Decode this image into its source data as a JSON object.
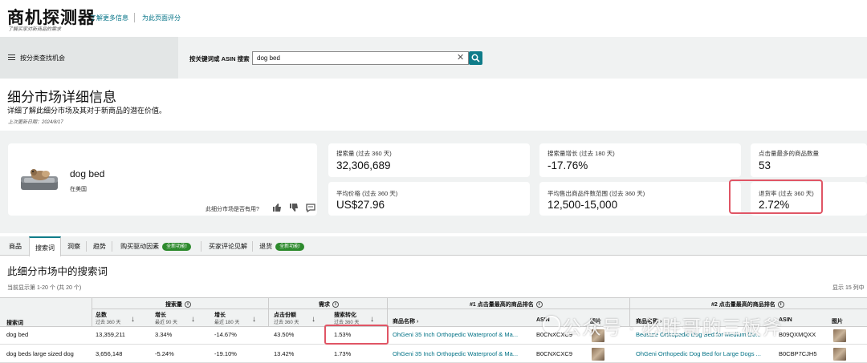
{
  "header": {
    "title": "商机探测器",
    "subtitle": "了解买家对新商品的需求",
    "learn_more": "了解更多信息",
    "rate_page": "为此页面评分"
  },
  "search": {
    "category_label": "按分类查找机会",
    "keyword_label": "按关键词或 ASIN 搜索",
    "value": "dog bed",
    "clear_icon": "close-icon",
    "search_icon": "search-icon"
  },
  "page": {
    "title": "细分市场详细信息",
    "description": "详细了解此细分市场及其对于新商品的潜在价值。",
    "updated": "上次更新日期：2024/8/17"
  },
  "niche": {
    "name": "dog bed",
    "market": "在美国",
    "useful_question": "此细分市场是否有用?"
  },
  "metrics": [
    {
      "label": "搜索量 (过去 360 天)",
      "value": "32,306,689"
    },
    {
      "label": "搜索量增长 (过去 180 天)",
      "value": "-17.76%"
    },
    {
      "label": "点击量最多的商品数量",
      "value": "53"
    },
    {
      "label": "平均价格 (过去 360 天)",
      "value": "US$27.96"
    },
    {
      "label": "平均售出商品件数范围 (过去 360 天)",
      "value": "12,500-15,000"
    },
    {
      "label": "退货率 (过去 360 天)",
      "value": "2.72%"
    }
  ],
  "tabs": [
    {
      "label": "商品"
    },
    {
      "label": "搜索词"
    },
    {
      "label": "洞察"
    },
    {
      "label": "趋势"
    },
    {
      "label": "购买驱动因素",
      "badge": "全新功能!"
    },
    {
      "label": "买家评论见解"
    },
    {
      "label": "退货",
      "badge": "全新功能!"
    }
  ],
  "section": {
    "title": "此细分市场中的搜索词",
    "showing": "当前显示第 1-20 个 (共 20 个)",
    "showing_right": "显示 15 列中"
  },
  "table": {
    "groups": {
      "search_volume": "搜索量",
      "demand": "需求",
      "top1": "#1 点击量最高的商品排名",
      "top2": "#2 点击量最高的商品排名"
    },
    "headers": {
      "term": "搜索词",
      "total": "总数",
      "total_sub": "过去 360 天",
      "growth90": "增长",
      "growth90_sub": "最近 90 天",
      "growth180": "增长",
      "growth180_sub": "最近 180 天",
      "click_share": "点击份额",
      "click_share_sub": "过去 360 天",
      "conversion": "搜索转化",
      "conversion_sub": "过去 360 天",
      "product_name": "商品名称",
      "asin": "ASIN",
      "image": "图片"
    },
    "rows": [
      {
        "term": "dog bed",
        "total": "13,359,211",
        "growth90": "3.34%",
        "growth180": "-14.67%",
        "click_share": "43.50%",
        "conversion": "1.53%",
        "p1_name": "OhGeni 35 Inch Orthopedic Waterproof & Ma...",
        "p1_asin": "B0CNXCXC9",
        "p2_name": "Bedsure Orthopedic Dog Bed for Medium Do...",
        "p2_asin": "B09QXMQXX"
      },
      {
        "term": "dog beds large sized dog",
        "total": "3,656,148",
        "growth90": "-5.24%",
        "growth180": "-19.10%",
        "click_share": "13.42%",
        "conversion": "1.73%",
        "p1_name": "OhGeni 35 Inch Orthopedic Waterproof & Ma...",
        "p1_asin": "B0CNXCXC9",
        "p2_name": "OhGeni Orthopedic Dog Bed for Large Dogs ...",
        "p2_asin": "B0CBP7CJH5"
      }
    ]
  },
  "watermark": "公众号 · 必胜哥的三板斧",
  "colors": {
    "accent": "#0f7c89",
    "link": "#007185",
    "highlight": "#e05565",
    "badge": "#2d8a2d"
  }
}
